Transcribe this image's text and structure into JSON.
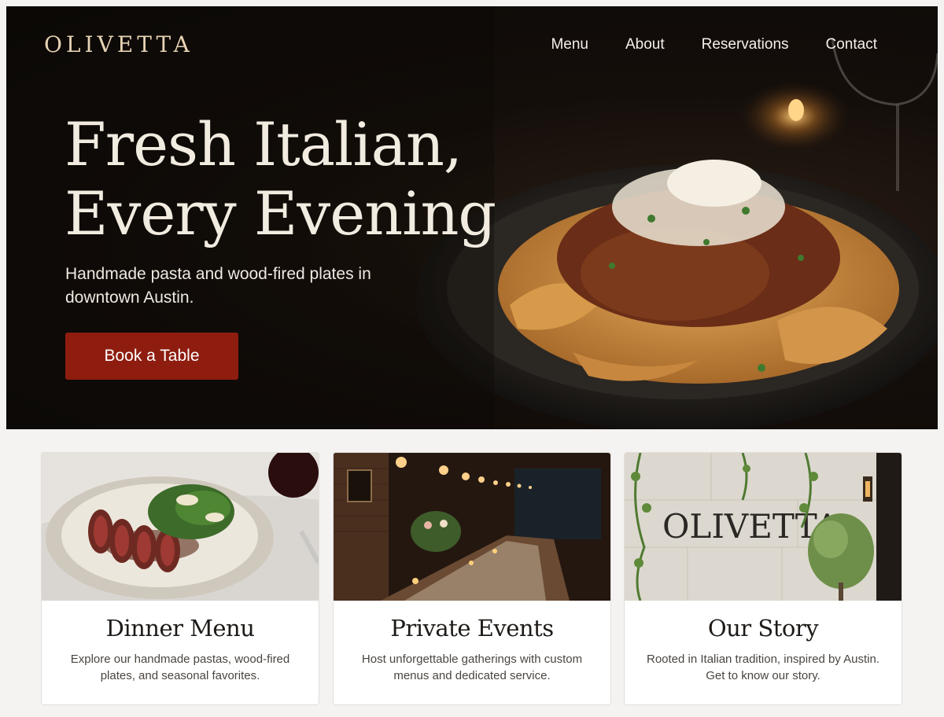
{
  "brand": {
    "name": "OLIVETTA"
  },
  "nav": {
    "items": [
      "Menu",
      "About",
      "Reservations",
      "Contact"
    ]
  },
  "hero": {
    "title_line1": "Fresh Italian,",
    "title_line2": "Every Evening",
    "subtitle": "Handmade pasta and wood-fired plates in downtown Austin.",
    "cta_label": "Book a Table"
  },
  "cards": [
    {
      "title": "Dinner Menu",
      "description": "Explore our handmade pastas, wood-fired plates, and seasonal favorites.",
      "image": "steak-salad-photo"
    },
    {
      "title": "Private Events",
      "description": "Host unforgettable gatherings with custom menus and dedicated service.",
      "image": "dining-room-photo"
    },
    {
      "title": "Our Story",
      "description": "Rooted in Italian tradition, inspired by Austin. Get to know our story.",
      "image": "storefront-photo",
      "sign_text": "OLIVETTA"
    }
  ],
  "colors": {
    "accent": "#8e1d10",
    "logo": "#e7d2b4",
    "hero_bg": "#0b0907"
  }
}
